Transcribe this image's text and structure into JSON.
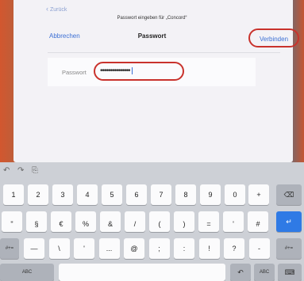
{
  "dialog": {
    "back_label": "Zurück",
    "prompt": "Passwort eingeben für „Concord“",
    "cancel_label": "Abbrechen",
    "title": "Passwort",
    "connect_label": "Verbinden",
    "field_label": "Passwort",
    "field_value": "•••••••••••••••"
  },
  "keyboard": {
    "toolbar": {
      "undo_icon": "undo-icon",
      "redo_icon": "redo-icon",
      "paste_icon": "paste-icon"
    },
    "row1": [
      "1",
      "2",
      "3",
      "4",
      "5",
      "6",
      "7",
      "8",
      "9",
      "0"
    ],
    "row2": [
      {
        "hint": "",
        "main": "\""
      },
      {
        "hint": "",
        "main": "§"
      },
      {
        "hint": "",
        "main": "€"
      },
      {
        "hint": "",
        "main": "%"
      },
      {
        "hint": "",
        "main": "&"
      },
      {
        "hint": "",
        "main": "/"
      },
      {
        "hint": "",
        "main": "("
      },
      {
        "hint": "",
        "main": ")"
      },
      {
        "hint": "",
        "main": "="
      },
      {
        "hint": "",
        "main": "'"
      },
      {
        "hint": "",
        "main": "#"
      }
    ],
    "row3": [
      "—",
      "\\",
      "'",
      "...",
      "@",
      ";",
      ":",
      "!",
      "?",
      "-"
    ],
    "row3_left": "#+=",
    "row3_right": "#+=",
    "plus_key": "+",
    "backspace_icon": "backspace-icon",
    "return_icon": "return-icon",
    "abc_label": "ABC",
    "undo_key_icon": "undo-icon",
    "abc_right_label": "ABC",
    "keyboard_hide_icon": "keyboard-icon"
  }
}
